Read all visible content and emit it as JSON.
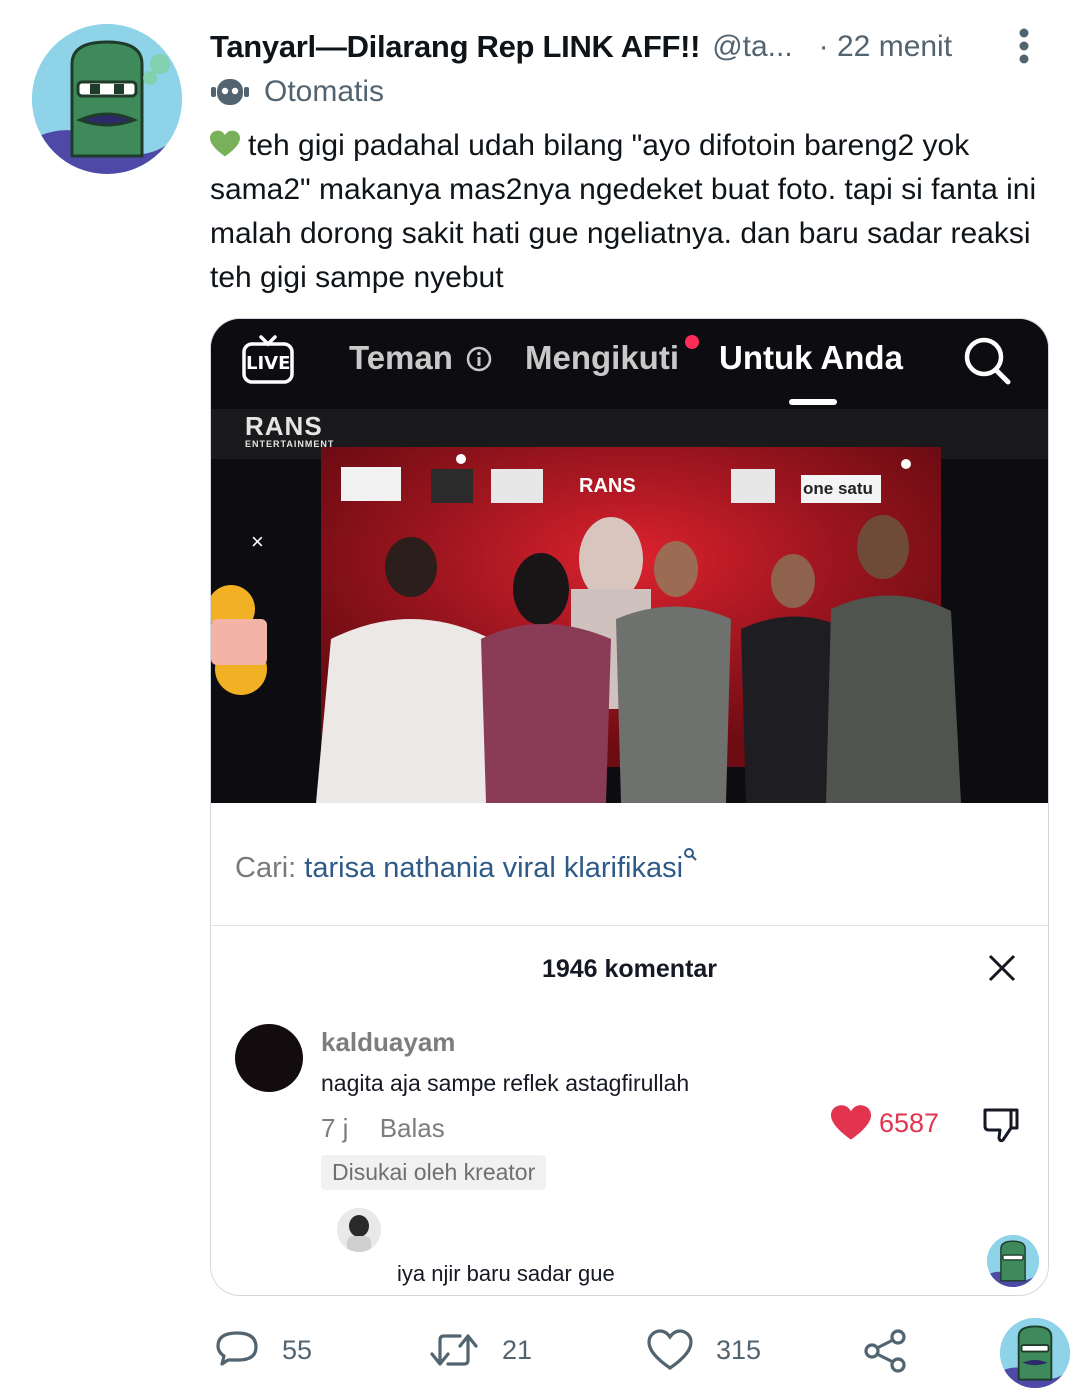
{
  "tweet": {
    "display_name": "Tanyarl—Dilarang Rep LINK AFF!!",
    "handle": "@ta...",
    "time": "· 22 menit",
    "bot_label": "Otomatis",
    "text": "teh gigi padahal udah bilang \"ayo difotoin bareng2 yok sama2\" makanya mas2nya ngedeket buat foto. tapi si fanta ini malah dorong sakit hati gue ngeliatnya. dan baru sadar reaksi teh gigi sampe nyebut"
  },
  "tiktok": {
    "nav": {
      "live": "LIVE",
      "friends": "Teman",
      "following": "Mengikuti",
      "for_you": "Untuk Anda"
    },
    "video_brand": "RANS",
    "video_brand_sub": "ENTERTAINMENT",
    "banner_logo": "RANS",
    "banner_logo2": "one satu",
    "search_prefix": "Cari:",
    "search_query": "tarisa nathania viral klarifikasi",
    "comment_count": "1946 komentar",
    "comment": {
      "user": "kalduayam",
      "text": "nagita aja sampe reflek astagfirullah",
      "age": "7 j",
      "reply": "Balas",
      "likes": "6587",
      "liked_by_creator": "Disukai oleh kreator"
    },
    "reply_text": "iya njir baru sadar gue"
  },
  "actions": {
    "replies": "55",
    "retweets": "21",
    "likes": "315"
  },
  "colors": {
    "text_primary": "#0f1419",
    "text_secondary": "#536471",
    "tiktok_red": "#e3344f",
    "heart_green": "#78b159"
  }
}
